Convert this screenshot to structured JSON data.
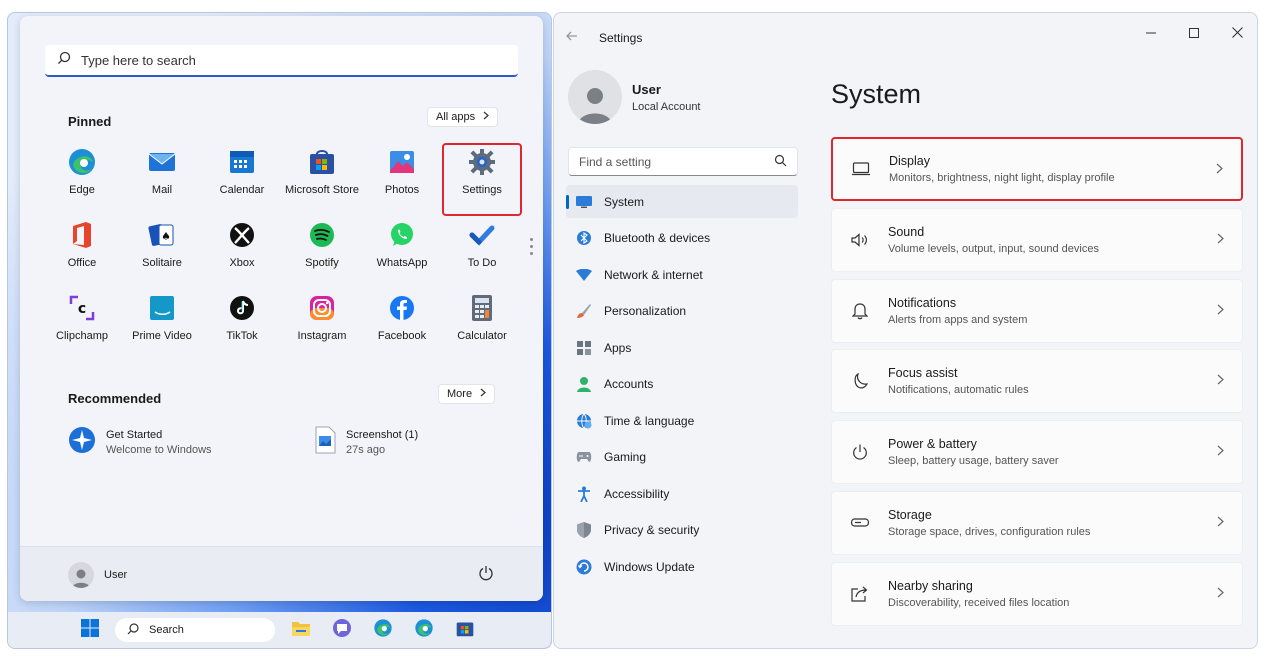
{
  "start_menu": {
    "search_placeholder": "Type here to search",
    "pinned_title": "Pinned",
    "all_apps_label": "All apps",
    "pinned_apps": [
      {
        "label": "Edge",
        "icon": "edge-icon"
      },
      {
        "label": "Mail",
        "icon": "mail-icon"
      },
      {
        "label": "Calendar",
        "icon": "calendar-icon"
      },
      {
        "label": "Microsoft Store",
        "icon": "store-icon"
      },
      {
        "label": "Photos",
        "icon": "photos-icon"
      },
      {
        "label": "Settings",
        "icon": "settings-gear-icon",
        "highlighted": true
      },
      {
        "label": "Office",
        "icon": "office-icon"
      },
      {
        "label": "Solitaire",
        "icon": "solitaire-icon"
      },
      {
        "label": "Xbox",
        "icon": "xbox-icon"
      },
      {
        "label": "Spotify",
        "icon": "spotify-icon"
      },
      {
        "label": "WhatsApp",
        "icon": "whatsapp-icon"
      },
      {
        "label": "To Do",
        "icon": "todo-icon"
      },
      {
        "label": "Clipchamp",
        "icon": "clipchamp-icon"
      },
      {
        "label": "Prime Video",
        "icon": "prime-video-icon"
      },
      {
        "label": "TikTok",
        "icon": "tiktok-icon"
      },
      {
        "label": "Instagram",
        "icon": "instagram-icon"
      },
      {
        "label": "Facebook",
        "icon": "facebook-icon"
      },
      {
        "label": "Calculator",
        "icon": "calculator-icon"
      }
    ],
    "recommended_title": "Recommended",
    "more_label": "More",
    "recommended": [
      {
        "title": "Get Started",
        "subtitle": "Welcome to Windows",
        "icon": "get-started-icon"
      },
      {
        "title": "Screenshot (1)",
        "subtitle": "27s ago",
        "icon": "image-file-icon"
      }
    ],
    "user_name": "User",
    "prime_video_icon_text": "Prime Video"
  },
  "taskbar": {
    "search_label": "Search",
    "icons": [
      "windows-start-icon",
      "file-explorer-icon",
      "chat-icon",
      "edge-icon",
      "edge-icon",
      "store-icon"
    ]
  },
  "settings": {
    "window_title": "Settings",
    "user_name": "User",
    "account_type": "Local Account",
    "find_placeholder": "Find a setting",
    "page_title": "System",
    "nav": [
      {
        "label": "System",
        "icon": "system-icon",
        "active": true
      },
      {
        "label": "Bluetooth & devices",
        "icon": "bluetooth-icon"
      },
      {
        "label": "Network & internet",
        "icon": "network-icon"
      },
      {
        "label": "Personalization",
        "icon": "brush-icon"
      },
      {
        "label": "Apps",
        "icon": "apps-icon"
      },
      {
        "label": "Accounts",
        "icon": "accounts-icon"
      },
      {
        "label": "Time & language",
        "icon": "time-language-icon"
      },
      {
        "label": "Gaming",
        "icon": "gaming-icon"
      },
      {
        "label": "Accessibility",
        "icon": "accessibility-icon"
      },
      {
        "label": "Privacy & security",
        "icon": "shield-icon"
      },
      {
        "label": "Windows Update",
        "icon": "windows-update-icon"
      }
    ],
    "cards": [
      {
        "title": "Display",
        "subtitle": "Monitors, brightness, night light, display profile",
        "icon": "display-icon",
        "highlighted": true
      },
      {
        "title": "Sound",
        "subtitle": "Volume levels, output, input, sound devices",
        "icon": "sound-icon"
      },
      {
        "title": "Notifications",
        "subtitle": "Alerts from apps and system",
        "icon": "bell-icon"
      },
      {
        "title": "Focus assist",
        "subtitle": "Notifications, automatic rules",
        "icon": "moon-icon"
      },
      {
        "title": "Power & battery",
        "subtitle": "Sleep, battery usage, battery saver",
        "icon": "power-icon"
      },
      {
        "title": "Storage",
        "subtitle": "Storage space, drives, configuration rules",
        "icon": "storage-icon"
      },
      {
        "title": "Nearby sharing",
        "subtitle": "Discoverability, received files location",
        "icon": "share-icon"
      }
    ]
  },
  "colors": {
    "highlight_red": "#e0262f",
    "accent_blue": "#0067c0"
  }
}
